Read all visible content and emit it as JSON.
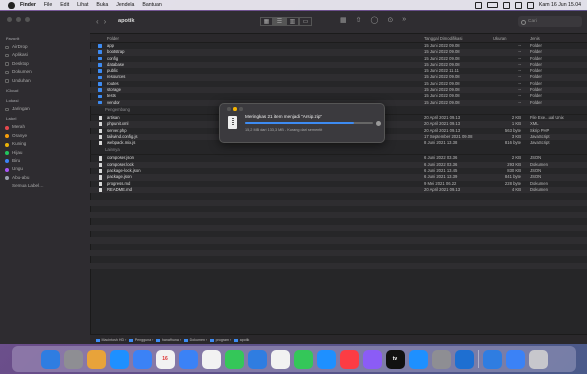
{
  "menubar": {
    "items": [
      "Finder",
      "File",
      "Edit",
      "Lihat",
      "Buka",
      "Jendela",
      "Bantuan"
    ],
    "clock": "Kam 16 Jun 15.04"
  },
  "window": {
    "title": "apotik",
    "sidebar": {
      "sections": [
        {
          "label": "Favorit",
          "items": [
            "AirDrop",
            "Aplikasi",
            "Desktop",
            "Dokumen",
            "Unduhan"
          ]
        },
        {
          "label": "iCloud",
          "items": []
        },
        {
          "label": "Lokasi",
          "items": [
            "Jaringan"
          ]
        },
        {
          "label": "Label",
          "items": [
            {
              "label": "Merah",
              "color": "#e5484d"
            },
            {
              "label": "Oranye",
              "color": "#f59e0b"
            },
            {
              "label": "Kuning",
              "color": "#eab308"
            },
            {
              "label": "Hijau",
              "color": "#22c55e"
            },
            {
              "label": "Biru",
              "color": "#3b82f6"
            },
            {
              "label": "Ungu",
              "color": "#a855f7"
            },
            {
              "label": "Abu-abu",
              "color": "#9ca3af"
            },
            {
              "label": "Semua Label…",
              "color": ""
            }
          ]
        }
      ]
    },
    "search": {
      "placeholder": "Cari"
    },
    "columns": {
      "name": "Folder",
      "date": "Tanggal Dimodifikasi",
      "size": "Ukuran",
      "kind": "Jenis"
    },
    "folders": [
      {
        "name": "app",
        "date": "15 Juni 2022 09.08",
        "size": "--",
        "kind": "Folder"
      },
      {
        "name": "bootstrap",
        "date": "15 Juni 2022 09.08",
        "size": "--",
        "kind": "Folder"
      },
      {
        "name": "config",
        "date": "15 Juni 2022 09.08",
        "size": "--",
        "kind": "Folder"
      },
      {
        "name": "database",
        "date": "15 Juni 2022 09.08",
        "size": "--",
        "kind": "Folder"
      },
      {
        "name": "public",
        "date": "15 Juni 2022 11.11",
        "size": "--",
        "kind": "Folder"
      },
      {
        "name": "resources",
        "date": "15 Juni 2022 09.08",
        "size": "--",
        "kind": "Folder"
      },
      {
        "name": "routes",
        "date": "15 Juni 2022 09.08",
        "size": "--",
        "kind": "Folder"
      },
      {
        "name": "storage",
        "date": "15 Juni 2022 09.08",
        "size": "--",
        "kind": "Folder"
      },
      {
        "name": "tests",
        "date": "15 Juni 2022 09.08",
        "size": "--",
        "kind": "Folder"
      },
      {
        "name": "vendor",
        "date": "15 Juni 2022 09.08",
        "size": "--",
        "kind": "Folder"
      }
    ],
    "group_dev": "Pengembang",
    "dev_files": [
      {
        "name": "artisan",
        "date": "20 April 2021 09.13",
        "size": "2 KB",
        "kind": "File Exe...ual Unix"
      },
      {
        "name": "phpunit.xml",
        "date": "20 April 2021 09.13",
        "size": "1 KB",
        "kind": "XML"
      },
      {
        "name": "server.php",
        "date": "20 April 2021 09.13",
        "size": "563 byte",
        "kind": "Skrip PHP"
      },
      {
        "name": "tailwind.config.js",
        "date": "17 September 2021 09.08",
        "size": "3 KB",
        "kind": "JavaScript"
      },
      {
        "name": "webpack.mix.js",
        "date": "8 Juni 2021 13.38",
        "size": "816 byte",
        "kind": "JavaScript"
      }
    ],
    "group_other": "Lainnya",
    "other_files": [
      {
        "name": "composer.json",
        "date": "6 Juni 2022 03.36",
        "size": "2 KB",
        "kind": "JSON"
      },
      {
        "name": "composer.lock",
        "date": "6 Juni 2022 03.36",
        "size": "293 KB",
        "kind": "Dokumen"
      },
      {
        "name": "package-lock.json",
        "date": "6 Juni 2021 13.45",
        "size": "830 KB",
        "kind": "JSON"
      },
      {
        "name": "package.json",
        "date": "6 Juni 2021 13.39",
        "size": "841 byte",
        "kind": "JSON"
      },
      {
        "name": "progress.md",
        "date": "9 Mei 2021 06.22",
        "size": "228 byte",
        "kind": "Dokumen"
      },
      {
        "name": "README.md",
        "date": "20 April 2021 09.13",
        "size": "4 KB",
        "kind": "Dokumen"
      }
    ],
    "pathbar": [
      "Macintosh HD",
      "Pengguna",
      "hanafhuna",
      "Dokumen",
      "program",
      "apotik"
    ]
  },
  "dialog": {
    "title": "Meringkas 21 item menjadi \"Arsip.zip\"",
    "status": "15,2 MB dari 133,3 MB - Kurang dari sementit",
    "progress": 0.85
  },
  "dock": {
    "apps": [
      {
        "name": "finder",
        "color": "#2f7de1",
        "label": ""
      },
      {
        "name": "launchpad",
        "color": "#8e8e93",
        "label": ""
      },
      {
        "name": "chrome",
        "color": "#e8a33a",
        "label": ""
      },
      {
        "name": "safari",
        "color": "#1e90ff",
        "label": ""
      },
      {
        "name": "mail",
        "color": "#3b82f6",
        "label": ""
      },
      {
        "name": "calendar",
        "color": "#f2f2f2",
        "label": "16"
      },
      {
        "name": "notes",
        "color": "#3b82f6",
        "label": ""
      },
      {
        "name": "photos",
        "color": "#f2f2f2",
        "label": ""
      },
      {
        "name": "facetime",
        "color": "#34c759",
        "label": ""
      },
      {
        "name": "messages",
        "color": "#2f7de1",
        "label": ""
      },
      {
        "name": "notes-yellow",
        "color": "#f2f2f2",
        "label": ""
      },
      {
        "name": "charts",
        "color": "#34c759",
        "label": ""
      },
      {
        "name": "keynote",
        "color": "#1e90ff",
        "label": ""
      },
      {
        "name": "music",
        "color": "#fc3c44",
        "label": ""
      },
      {
        "name": "podcasts",
        "color": "#8b5cf6",
        "label": ""
      },
      {
        "name": "tv",
        "color": "#111111",
        "label": "tv"
      },
      {
        "name": "app-store",
        "color": "#1e90ff",
        "label": ""
      },
      {
        "name": "system-preferences",
        "color": "#8e8e93",
        "label": ""
      },
      {
        "name": "vscode",
        "color": "#1e6fd1",
        "label": ""
      },
      {
        "name": "screen",
        "color": "#2f7de1",
        "label": ""
      },
      {
        "name": "terminal",
        "color": "#3b82f6",
        "label": ""
      },
      {
        "name": "trash",
        "color": "#c7c7cc",
        "label": ""
      }
    ]
  }
}
